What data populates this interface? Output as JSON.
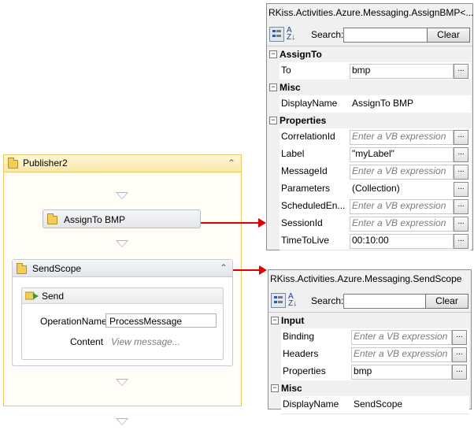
{
  "designer": {
    "publisher_title": "Publisher2",
    "assign_label": "AssignTo BMP",
    "sendscope_title": "SendScope",
    "send_title": "Send",
    "operation_label": "OperationName",
    "operation_value": "ProcessMessage",
    "content_label": "Content",
    "content_placeholder": "View message..."
  },
  "grid1": {
    "title": "RKiss.Activities.Azure.Messaging.AssignBMP<...",
    "search_label": "Search:",
    "clear_label": "Clear",
    "categories": [
      {
        "name": "AssignTo",
        "rows": [
          {
            "name": "To",
            "value": "bmp",
            "placeholder": false,
            "boxed": true
          }
        ]
      },
      {
        "name": "Misc",
        "rows": [
          {
            "name": "DisplayName",
            "value": "AssignTo BMP",
            "placeholder": false,
            "boxed": false,
            "noellipsis": true
          }
        ]
      },
      {
        "name": "Properties",
        "rows": [
          {
            "name": "CorrelationId",
            "value": "Enter a VB expression",
            "placeholder": true,
            "boxed": true
          },
          {
            "name": "Label",
            "value": "\"myLabel\"",
            "placeholder": false,
            "boxed": true
          },
          {
            "name": "MessageId",
            "value": "Enter a VB expression",
            "placeholder": true,
            "boxed": true
          },
          {
            "name": "Parameters",
            "value": "(Collection)",
            "placeholder": false,
            "boxed": false
          },
          {
            "name": "ScheduledEn...",
            "value": "Enter a VB expression",
            "placeholder": true,
            "boxed": true
          },
          {
            "name": "SessionId",
            "value": "Enter a VB expression",
            "placeholder": true,
            "boxed": true
          },
          {
            "name": "TimeToLive",
            "value": "00:10:00",
            "placeholder": false,
            "boxed": true
          }
        ]
      }
    ]
  },
  "grid2": {
    "title": "RKiss.Activities.Azure.Messaging.SendScope",
    "search_label": "Search:",
    "clear_label": "Clear",
    "categories": [
      {
        "name": "Input",
        "rows": [
          {
            "name": "Binding",
            "value": "Enter a VB expression",
            "placeholder": true,
            "boxed": true
          },
          {
            "name": "Headers",
            "value": "Enter a VB expression",
            "placeholder": true,
            "boxed": true
          },
          {
            "name": "Properties",
            "value": "bmp",
            "placeholder": false,
            "boxed": true
          }
        ]
      },
      {
        "name": "Misc",
        "rows": [
          {
            "name": "DisplayName",
            "value": "SendScope",
            "placeholder": false,
            "boxed": false,
            "noellipsis": true
          }
        ]
      }
    ]
  },
  "icons": {
    "collapse": "double-chevron-up-icon",
    "folder": "folder-activity-icon",
    "send": "send-arrow-icon",
    "drop": "drop-target-triangle-icon"
  },
  "colors": {
    "arrow": "#e00000",
    "scope_border": "#e8c96a"
  }
}
